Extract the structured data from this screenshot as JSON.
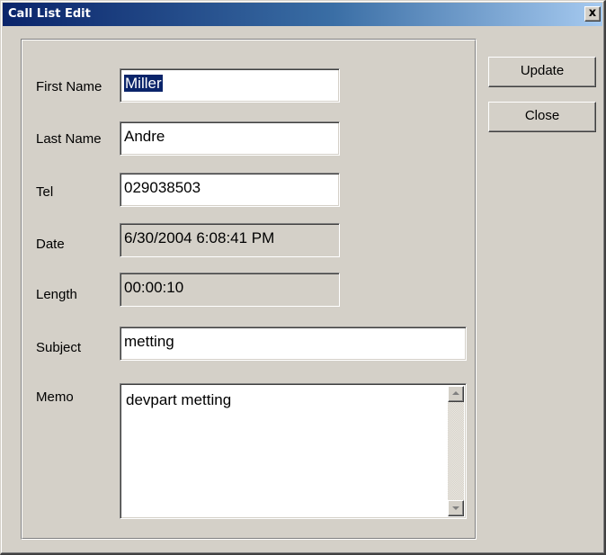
{
  "window": {
    "title": "Call List Edit",
    "close_glyph": "x"
  },
  "form": {
    "first_name": {
      "label": "First Name",
      "value": "Miller"
    },
    "last_name": {
      "label": "Last Name",
      "value": "Andre"
    },
    "tel": {
      "label": "Tel",
      "value": "029038503"
    },
    "date": {
      "label": "Date",
      "value": "6/30/2004 6:08:41 PM"
    },
    "length": {
      "label": "Length",
      "value": "00:00:10"
    },
    "subject": {
      "label": "Subject",
      "value": "metting"
    },
    "memo": {
      "label": "Memo",
      "value": "devpart metting"
    }
  },
  "buttons": {
    "update": "Update",
    "close": "Close"
  },
  "icons": {
    "close": "close-icon",
    "scroll_up": "scroll-up-arrow-icon",
    "scroll_down": "scroll-down-arrow-icon"
  },
  "colors": {
    "titlebar_start": "#0a246a",
    "titlebar_end": "#a6caf0",
    "dialog_face": "#d4d0c8",
    "selection": "#0a246a"
  }
}
